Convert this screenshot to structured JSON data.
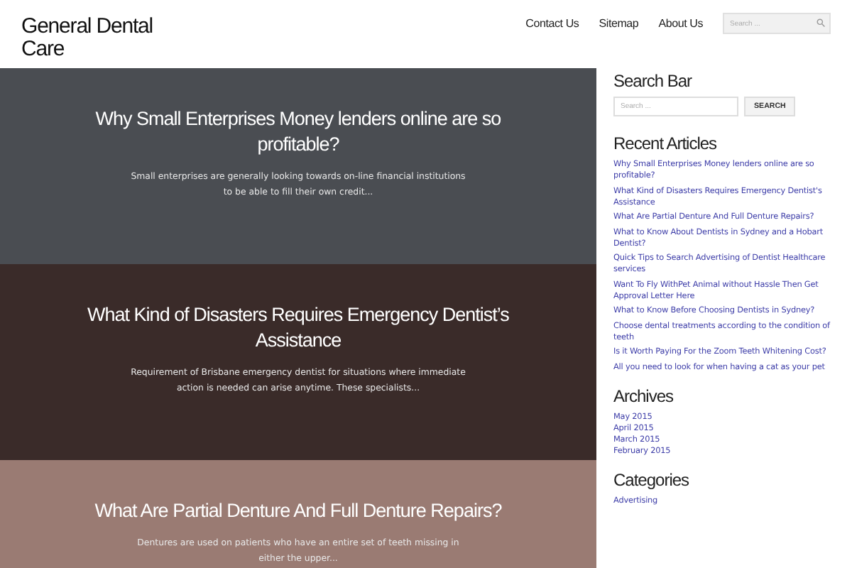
{
  "site_title": "General Dental Care",
  "nav": {
    "links": [
      "Contact Us",
      "Sitemap",
      "About Us"
    ],
    "search": {
      "placeholder": "Search ..."
    }
  },
  "posts": [
    {
      "title": "Why Small Enterprises Money lenders online are so profitable?",
      "excerpt": "Small enterprises are generally looking towards on-line financial institutions to be able to fill their own credit...",
      "color": "#4a4d52"
    },
    {
      "title": "What Kind of Disasters Requires Emergency Dentist’s Assistance",
      "excerpt": "Requirement of Brisbane emergency dentist for situations where immediate action is needed can arise anytime. These specialists...",
      "color": "#3a2b29"
    },
    {
      "title": "What Are Partial Denture And Full Denture Repairs?",
      "excerpt": "Dentures are used on patients who have an entire set of teeth missing in either the upper...",
      "color": "#9a7b73"
    }
  ],
  "sidebar": {
    "search": {
      "heading": "Search Bar",
      "placeholder": "Search ...",
      "button": "SEARCH"
    },
    "recent": {
      "heading": "Recent Articles",
      "items": [
        "Why Small Enterprises Money lenders online are so profitable?",
        "What Kind of Disasters Requires Emergency Dentist's Assistance",
        "What Are Partial Denture And Full Denture Repairs?",
        "What to Know About Dentists in Sydney and a Hobart Dentist?",
        "Quick Tips to Search Advertising of Dentist Healthcare services",
        "Want To Fly WithPet Animal without Hassle Then Get Approval Letter Here",
        "What to Know Before Choosing Dentists in Sydney?",
        "Choose dental treatments according to the condition of teeth",
        "Is it Worth Paying For the Zoom Teeth Whitening Cost?",
        "All you need to look for when having a cat as your pet"
      ]
    },
    "archives": {
      "heading": "Archives",
      "items": [
        "May 2015",
        "April 2015",
        "March 2015",
        "February 2015"
      ]
    },
    "categories": {
      "heading": "Categories",
      "items": [
        "Advertising"
      ]
    }
  }
}
